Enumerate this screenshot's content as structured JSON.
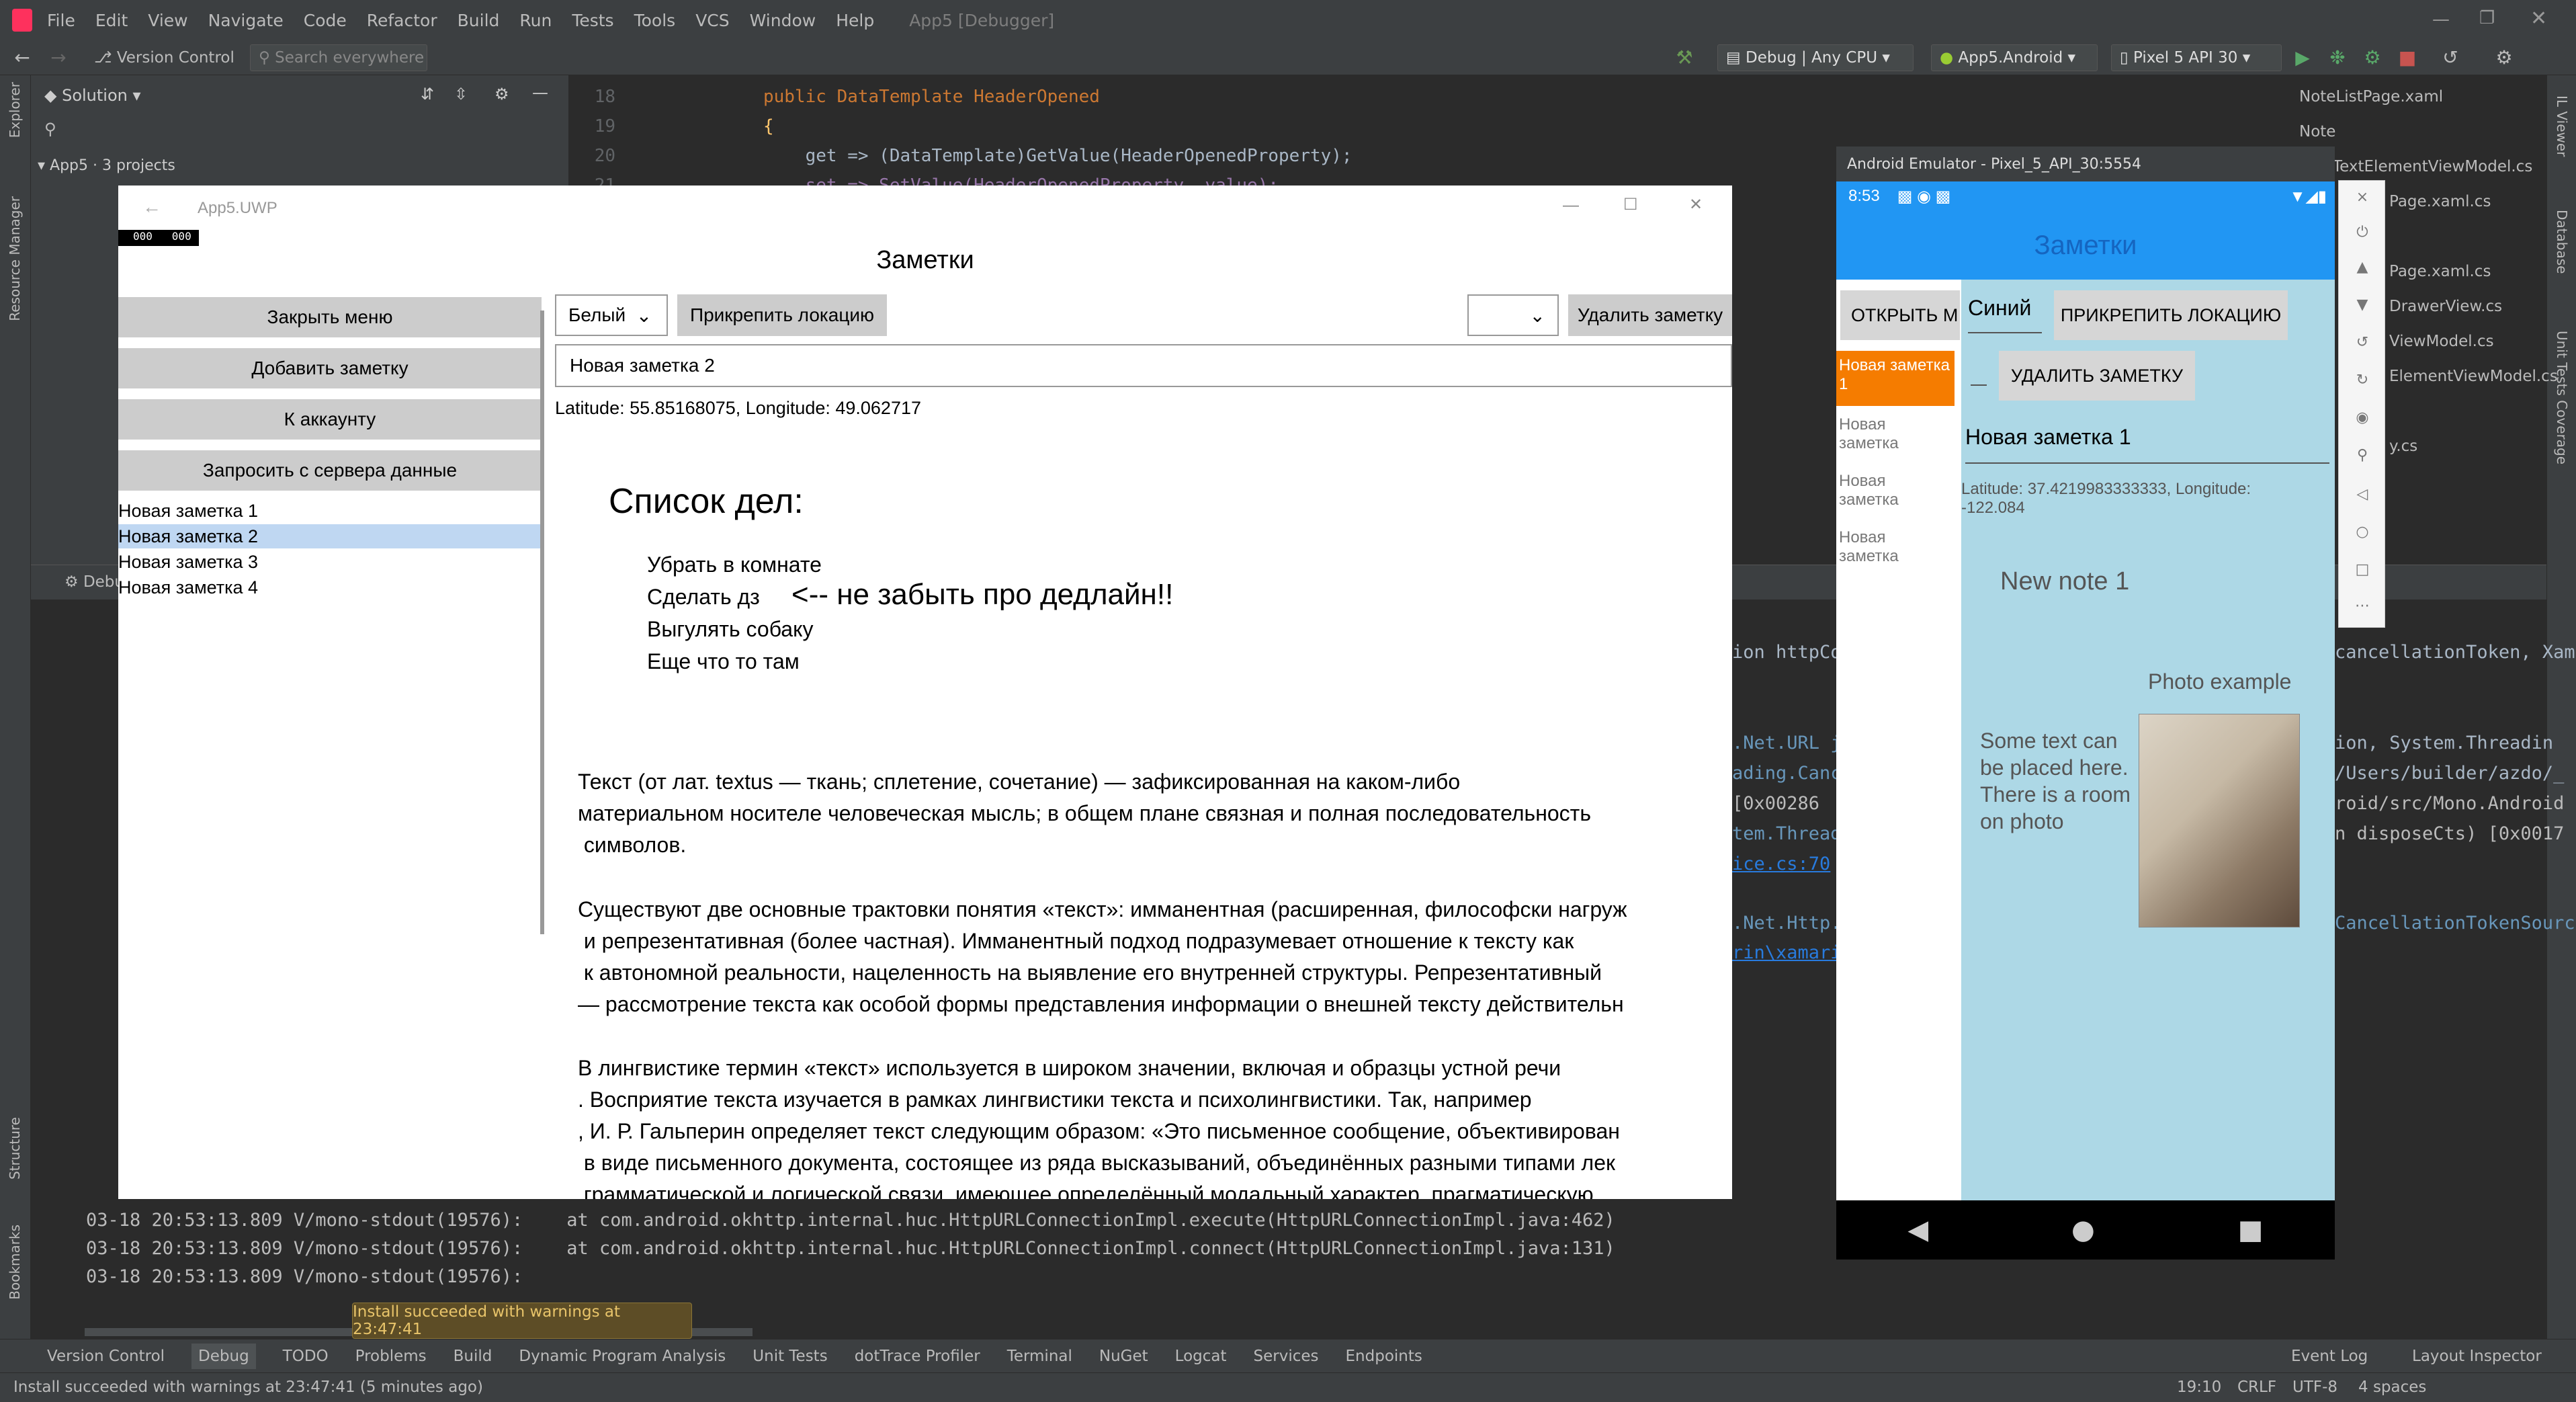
{
  "menubar": {
    "items": [
      "File",
      "Edit",
      "View",
      "Navigate",
      "Code",
      "Refactor",
      "Build",
      "Run",
      "Tests",
      "Tools",
      "VCS",
      "Window",
      "Help"
    ],
    "window_title": "App5 [Debugger]"
  },
  "toolbar": {
    "version_control": "Version Control",
    "search_placeholder": "Search everywhere",
    "config": "Debug | Any CPU",
    "project": "App5.Android",
    "device": "Pixel 5 API 30"
  },
  "solution": {
    "title": "Solution",
    "root": "App5 · 3 projects"
  },
  "editor": {
    "lines": [
      {
        "num": "18",
        "text": "public DataTemplate HeaderOpened"
      },
      {
        "num": "19",
        "text": "{"
      },
      {
        "num": "20",
        "text": "    get => (DataTemplate)GetValue(HeaderOpenedProperty);"
      },
      {
        "num": "21",
        "text": "    set => SetValue(HeaderOpenedProperty, value);"
      }
    ]
  },
  "right_tabs": [
    "NoteListPage.xaml",
    "Note",
    "TextElementViewModel.cs",
    "Page.xaml.cs",
    "Page.xaml.cs",
    "DrawerView.cs",
    "ViewModel.cs",
    "ElementViewModel.cs",
    "y.cs"
  ],
  "right_tool_labels": [
    "IL Viewer",
    "Database",
    "Unit Tests Coverage"
  ],
  "left_tool_labels": [
    "Explorer",
    "Resource Manager",
    "Structure",
    "Bookmarks"
  ],
  "debug": {
    "tab": "Debug",
    "log_lines": [
      "03-18 20:53:13.809 V/mono-stdout(19576):    at com.android.okhttp.internal.huc.HttpURLConnectionImpl.execute(HttpURLConnectionImpl.java:462)",
      "03-18 20:53:13.809 V/mono-stdout(19576):    at com.android.okhttp.internal.huc.HttpURLConnectionImpl.connect(HttpURLConnectionImpl.java:131)",
      "03-18 20:53:13.809 V/mono-stdout(19576):"
    ],
    "right_fragments": [
      "ion httpCo",
      "cancellationToken, Xam",
      ".Net.URL j",
      "ion, System.Threadin",
      "ading.Canc",
      "/Users/builder/azdo/_",
      "[0x00286",
      "roid/src/Mono.Android",
      "tem.Thread",
      "n disposeCts) [0x0017",
      "ice.cs:70",
      ".Net.Http.",
      "CancellationTokenSourc",
      "rin\\xamari"
    ]
  },
  "uwp": {
    "window_title": "App5.UWP",
    "fps": "000   000",
    "header": "Заметки",
    "menu_buttons": [
      "Закрыть меню",
      "Добавить заметку",
      "К аккаунту",
      "Запросить с сервера данные"
    ],
    "notes": [
      "Новая заметка 1",
      "Новая заметка 2",
      "Новая заметка 3",
      "Новая заметка 4"
    ],
    "selected_note": "Новая заметка 2",
    "color_select": "Белый",
    "pin_location": "Прикрепить локацию",
    "delete_note": "Удалить заметку",
    "note_title": "Новая заметка 2",
    "location": "Latitude: 55.85168075, Longitude: 49.062717",
    "todo_title": "Список дел:",
    "todo_items": [
      "Убрать в комнате",
      "Сделать дз",
      "Выгулять собаку",
      "Еще что то там"
    ],
    "deadline": "<-- не забыть про дедлайн!!",
    "paragraphs": [
      "Текст (от лат. textus — ткань; сплетение, сочетание) — зафиксированная на каком-либо",
      "материальном носителе человеческая мысль; в общем плане связная и полная последовательность",
      " символов.",
      "Существуют две основные трактовки понятия «текст»: имманентная (расширенная, философски нагруж",
      " и репрезентативная (более частная). Имманентный подход подразумевает отношение к тексту как",
      " к автономной реальности, нацеленность на выявление его внутренней структуры. Репрезентативный",
      "— рассмотрение текста как особой формы представления информации о внешней тексту действительн",
      "В лингвистике термин «текст» используется в широком значении, включая и образцы устной речи",
      ". Восприятие текста изучается в рамках лингвистики текста и психолингвистики. Так, например",
      ", И. Р. Гальперин определяет текст следующим образом: «Это письменное сообщение, объективирован",
      " в виде письменного документа, состоящее из ряда высказываний, объединённых разными типами лек",
      " грамматической и логической связи, имеющее определённый модальный характер, прагматическую"
    ]
  },
  "emulator": {
    "title": "Android Emulator - Pixel_5_API_30:5554",
    "time": "8:53",
    "app_title": "Заметки",
    "open_menu": "ОТКРЫТЬ М",
    "color": "Синий",
    "pin_location": "ПРИКРЕПИТЬ ЛОКАЦИЮ",
    "delete_note": "УДАЛИТЬ ЗАМЕТКУ",
    "notes": [
      "Новая заметка 1",
      "Новая заметка",
      "Новая заметка",
      "Новая заметка"
    ],
    "note_title": "Новая заметка 1",
    "location": "Latitude: 37.4219983333333, Longitude: -122.084",
    "new_note": "New note 1",
    "photo_caption": "Photo example",
    "photo_text": "Some text can be placed here. There is a room on photo"
  },
  "bottom_tabs": [
    "Version Control",
    "Debug",
    "TODO",
    "Problems",
    "Build",
    "Dynamic Program Analysis",
    "Unit Tests",
    "dotTrace Profiler",
    "Terminal",
    "NuGet",
    "Logcat",
    "Services",
    "Endpoints"
  ],
  "bottom_right": [
    "Event Log",
    "Layout Inspector"
  ],
  "toast": "Install succeeded with warnings at 23:47:41",
  "status": {
    "message": "Install succeeded with warnings at 23:47:41 (5 minutes ago)",
    "position": "19:10",
    "line_sep": "CRLF",
    "encoding": "UTF-8",
    "indent": "4 spaces"
  },
  "colors": {
    "ide_bg": "#2b2b2b",
    "ide_panel": "#3c3f41",
    "selection_uwp": "#bfd7f2",
    "android_blue": "#2196f3",
    "android_orange": "#f57c00",
    "android_content": "#add8e6"
  }
}
